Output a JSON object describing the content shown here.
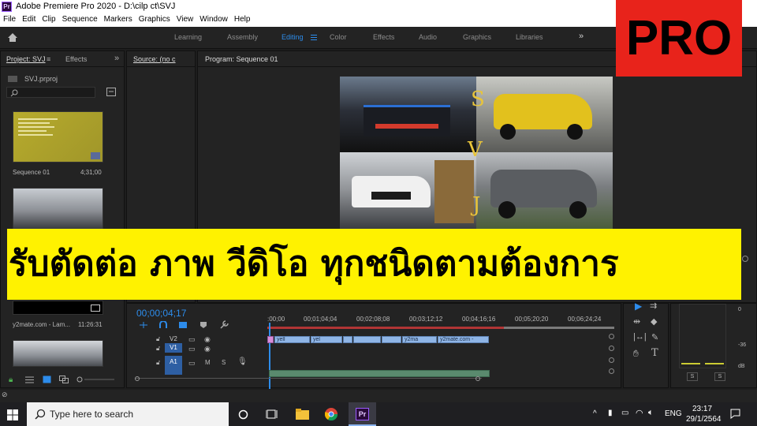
{
  "titlebar": {
    "app_icon": "Pr",
    "title": "Adobe Premiere Pro 2020 - D:\\cilp ct\\SVJ"
  },
  "menu": [
    "File",
    "Edit",
    "Clip",
    "Sequence",
    "Markers",
    "Graphics",
    "View",
    "Window",
    "Help"
  ],
  "workspaces": [
    {
      "label": "Learning",
      "active": false
    },
    {
      "label": "Assembly",
      "active": false
    },
    {
      "label": "Editing",
      "active": true
    },
    {
      "label": "Color",
      "active": false
    },
    {
      "label": "Effects",
      "active": false
    },
    {
      "label": "Audio",
      "active": false
    },
    {
      "label": "Graphics",
      "active": false
    },
    {
      "label": "Libraries",
      "active": false
    }
  ],
  "project_panel": {
    "tab_project": "Project: SVJ",
    "tab_effects": "Effects",
    "project_file": "SVJ.prproj",
    "items": [
      {
        "name": "Sequence 01",
        "duration": "4;31;00"
      },
      {
        "name": "y2mate.com - Lam...",
        "duration": "11:26:31"
      }
    ]
  },
  "source_panel": {
    "tab": "Source: (no c"
  },
  "program_panel": {
    "tab": "Program: Sequence 01",
    "overlay_letters": [
      "S",
      "V",
      "J"
    ]
  },
  "timeline": {
    "timecode": "00;00;04;17",
    "ruler": [
      ":00;00",
      "00;01;04;04",
      "00;02;08;08",
      "00;03;12;12",
      "00;04;16;16",
      "00;05;20;20",
      "00;06;24;24"
    ],
    "tracks": [
      {
        "id": "V2"
      },
      {
        "id": "V1"
      },
      {
        "id": "A1",
        "m": "M",
        "s": "S"
      }
    ],
    "v1_clips": [
      "yell",
      "yel",
      "y2ma",
      "y2mate.com -"
    ]
  },
  "audio_meter": {
    "scale": [
      "0",
      "-36",
      "dB"
    ],
    "solo": [
      "S",
      "S"
    ]
  },
  "banner_text": "รับตัดต่อ ภาพ วีดิโอ  ทุกชนิดตามต้องการ",
  "pro_badge": "PRO",
  "taskbar": {
    "search_placeholder": "Type here to search",
    "language": "ENG",
    "time": "23:17",
    "date": "29/1/2564"
  },
  "colors": {
    "accent": "#2d8ceb",
    "banner": "#fff200",
    "pro_badge": "#e8231b"
  }
}
